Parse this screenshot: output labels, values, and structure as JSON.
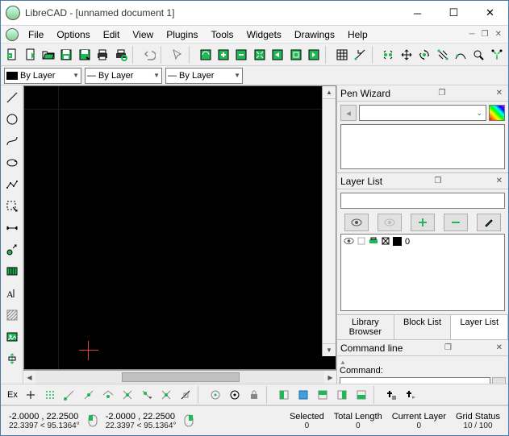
{
  "title": "LibreCAD - [unnamed document 1]",
  "menu": [
    "File",
    "Options",
    "Edit",
    "View",
    "Plugins",
    "Tools",
    "Widgets",
    "Drawings",
    "Help"
  ],
  "pen": {
    "color": "By Layer",
    "width": "— By Layer",
    "type": "— By Layer"
  },
  "panels": {
    "penwizard": "Pen Wizard",
    "layerlist": "Layer List",
    "cmdline": "Command line",
    "cmdlabel": "Command:"
  },
  "layer0": "0",
  "tabs": [
    "Library Browser",
    "Block List",
    "Layer List"
  ],
  "snap_ex": "Ex",
  "status": {
    "coord1": "-2.0000 , 22.2500",
    "polar1": "22.3397 < 95.1364°",
    "coord2": "-2.0000 , 22.2500",
    "polar2": "22.3397 < 95.1364°",
    "sel_h": "Selected",
    "sel_v": "0",
    "len_h": "Total Length",
    "len_v": "0",
    "cur_h": "Current Layer",
    "cur_v": "0",
    "grid_h": "Grid Status",
    "grid_v": "10 / 100"
  }
}
